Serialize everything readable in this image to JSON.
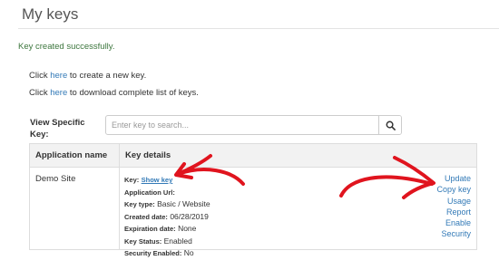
{
  "page": {
    "title": "My keys",
    "success_message": "Key created successfully."
  },
  "links": {
    "create_prefix": "Click ",
    "create_link": "here",
    "create_suffix": " to create a new key.",
    "download_prefix": "Click ",
    "download_link": "here",
    "download_suffix": " to download complete list of keys."
  },
  "search": {
    "label": "View Specific Key:",
    "placeholder": "Enter key to search...",
    "button_icon": "search-icon"
  },
  "table": {
    "headers": [
      "Application name",
      "Key details"
    ],
    "rows": [
      {
        "application_name": "Demo Site",
        "details": {
          "key_label": "Key:",
          "show_key": "Show key",
          "app_url_label": "Application Url:",
          "app_url_value": "",
          "key_type_label": "Key type:",
          "key_type_value": "Basic / Website",
          "created_label": "Created date:",
          "created_value": "06/28/2019",
          "expiration_label": "Expiration date:",
          "expiration_value": "None",
          "status_label": "Key Status:",
          "status_value": "Enabled",
          "security_label": "Security Enabled:",
          "security_value": "No"
        },
        "actions": [
          "Update",
          "Copy key",
          "Usage",
          "Report",
          "Enable",
          "Security"
        ]
      }
    ]
  },
  "colors": {
    "link": "#337ab7",
    "success": "#3c763d",
    "annotation_arrow": "#e0141e"
  }
}
